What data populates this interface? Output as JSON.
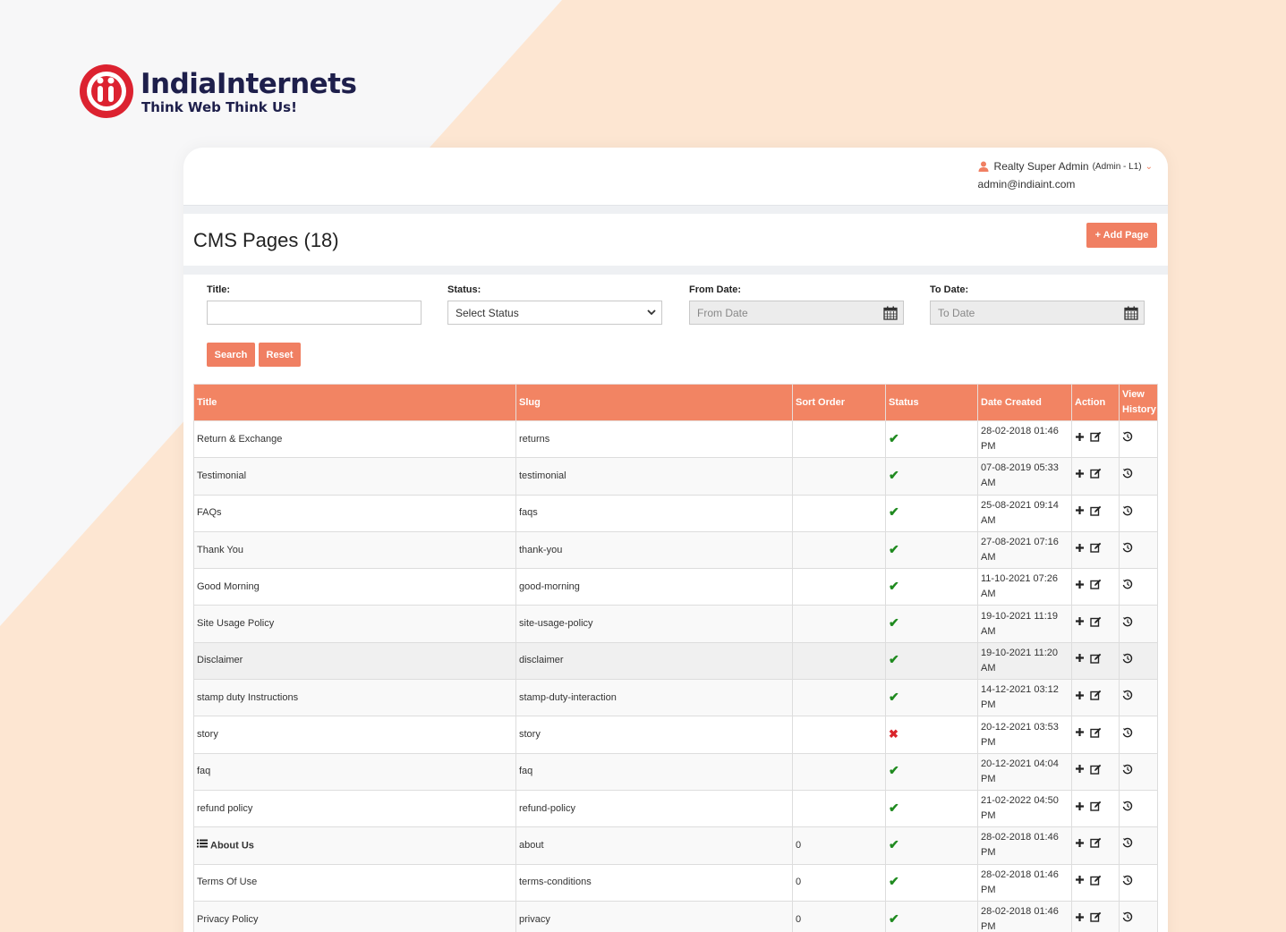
{
  "brand": {
    "name": "IndiaInternets",
    "tagline": "Think Web Think Us!",
    "primary_color": "#dc2230",
    "text_color": "#1e1f4b"
  },
  "user": {
    "name": "Realty Super Admin",
    "role": "(Admin - L1)",
    "email": "admin@indiaint.com"
  },
  "page": {
    "title": "CMS Pages (18)",
    "add_button": "+ Add Page",
    "accent_color": "#f07f62"
  },
  "filters": {
    "title_label": "Title:",
    "title_value": "",
    "status_label": "Status:",
    "status_value": "Select Status",
    "from_label": "From Date:",
    "from_placeholder": "From Date",
    "to_label": "To Date:",
    "to_placeholder": "To Date",
    "search_button": "Search",
    "reset_button": "Reset"
  },
  "table": {
    "columns": [
      "Title",
      "Slug",
      "Sort Order",
      "Status",
      "Date Created",
      "Action",
      "View History"
    ],
    "rows": [
      {
        "title": "Return & Exchange",
        "slug": "returns",
        "sort": "",
        "status": "active",
        "date": "28-02-2018 01:46 PM",
        "menu_icon": false
      },
      {
        "title": "Testimonial",
        "slug": "testimonial",
        "sort": "",
        "status": "active",
        "date": "07-08-2019 05:33 AM",
        "menu_icon": false
      },
      {
        "title": "FAQs",
        "slug": "faqs",
        "sort": "",
        "status": "active",
        "date": "25-08-2021 09:14 AM",
        "menu_icon": false
      },
      {
        "title": "Thank You",
        "slug": "thank-you",
        "sort": "",
        "status": "active",
        "date": "27-08-2021 07:16 AM",
        "menu_icon": false
      },
      {
        "title": "Good Morning",
        "slug": "good-morning",
        "sort": "",
        "status": "active",
        "date": "11-10-2021 07:26 AM",
        "menu_icon": false
      },
      {
        "title": "Site Usage Policy",
        "slug": "site-usage-policy",
        "sort": "",
        "status": "active",
        "date": "19-10-2021 11:19 AM",
        "menu_icon": false
      },
      {
        "title": "Disclaimer",
        "slug": "disclaimer",
        "sort": "",
        "status": "active",
        "date": "19-10-2021 11:20 AM",
        "menu_icon": false
      },
      {
        "title": "stamp duty Instructions",
        "slug": "stamp-duty-interaction",
        "sort": "",
        "status": "active",
        "date": "14-12-2021 03:12 PM",
        "menu_icon": false
      },
      {
        "title": "story",
        "slug": "story",
        "sort": "",
        "status": "inactive",
        "date": "20-12-2021 03:53 PM",
        "menu_icon": false
      },
      {
        "title": "faq",
        "slug": "faq",
        "sort": "",
        "status": "active",
        "date": "20-12-2021 04:04 PM",
        "menu_icon": false
      },
      {
        "title": "refund policy",
        "slug": "refund-policy",
        "sort": "",
        "status": "active",
        "date": "21-02-2022 04:50 PM",
        "menu_icon": false
      },
      {
        "title": "About Us",
        "slug": "about",
        "sort": "0",
        "status": "active",
        "date": "28-02-2018 01:46 PM",
        "menu_icon": true
      },
      {
        "title": "Terms Of Use",
        "slug": "terms-conditions",
        "sort": "0",
        "status": "active",
        "date": "28-02-2018 01:46 PM",
        "menu_icon": false
      },
      {
        "title": "Privacy Policy",
        "slug": "privacy",
        "sort": "0",
        "status": "active",
        "date": "28-02-2018 01:46 PM",
        "menu_icon": false
      }
    ]
  }
}
